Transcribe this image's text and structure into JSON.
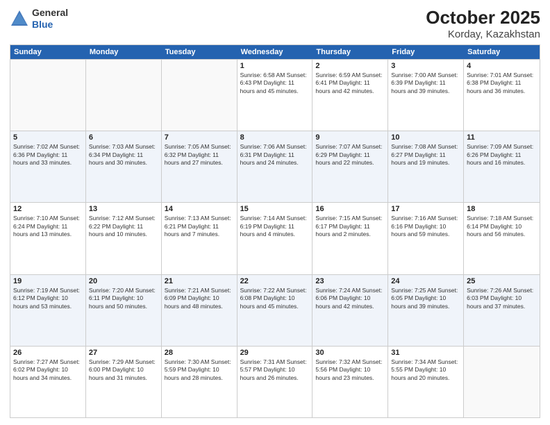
{
  "header": {
    "logo": {
      "general": "General",
      "blue": "Blue"
    },
    "month": "October 2025",
    "location": "Korday, Kazakhstan"
  },
  "days_of_week": [
    "Sunday",
    "Monday",
    "Tuesday",
    "Wednesday",
    "Thursday",
    "Friday",
    "Saturday"
  ],
  "weeks": [
    [
      {
        "day": "",
        "info": ""
      },
      {
        "day": "",
        "info": ""
      },
      {
        "day": "",
        "info": ""
      },
      {
        "day": "1",
        "info": "Sunrise: 6:58 AM\nSunset: 6:43 PM\nDaylight: 11 hours\nand 45 minutes."
      },
      {
        "day": "2",
        "info": "Sunrise: 6:59 AM\nSunset: 6:41 PM\nDaylight: 11 hours\nand 42 minutes."
      },
      {
        "day": "3",
        "info": "Sunrise: 7:00 AM\nSunset: 6:39 PM\nDaylight: 11 hours\nand 39 minutes."
      },
      {
        "day": "4",
        "info": "Sunrise: 7:01 AM\nSunset: 6:38 PM\nDaylight: 11 hours\nand 36 minutes."
      }
    ],
    [
      {
        "day": "5",
        "info": "Sunrise: 7:02 AM\nSunset: 6:36 PM\nDaylight: 11 hours\nand 33 minutes."
      },
      {
        "day": "6",
        "info": "Sunrise: 7:03 AM\nSunset: 6:34 PM\nDaylight: 11 hours\nand 30 minutes."
      },
      {
        "day": "7",
        "info": "Sunrise: 7:05 AM\nSunset: 6:32 PM\nDaylight: 11 hours\nand 27 minutes."
      },
      {
        "day": "8",
        "info": "Sunrise: 7:06 AM\nSunset: 6:31 PM\nDaylight: 11 hours\nand 24 minutes."
      },
      {
        "day": "9",
        "info": "Sunrise: 7:07 AM\nSunset: 6:29 PM\nDaylight: 11 hours\nand 22 minutes."
      },
      {
        "day": "10",
        "info": "Sunrise: 7:08 AM\nSunset: 6:27 PM\nDaylight: 11 hours\nand 19 minutes."
      },
      {
        "day": "11",
        "info": "Sunrise: 7:09 AM\nSunset: 6:26 PM\nDaylight: 11 hours\nand 16 minutes."
      }
    ],
    [
      {
        "day": "12",
        "info": "Sunrise: 7:10 AM\nSunset: 6:24 PM\nDaylight: 11 hours\nand 13 minutes."
      },
      {
        "day": "13",
        "info": "Sunrise: 7:12 AM\nSunset: 6:22 PM\nDaylight: 11 hours\nand 10 minutes."
      },
      {
        "day": "14",
        "info": "Sunrise: 7:13 AM\nSunset: 6:21 PM\nDaylight: 11 hours\nand 7 minutes."
      },
      {
        "day": "15",
        "info": "Sunrise: 7:14 AM\nSunset: 6:19 PM\nDaylight: 11 hours\nand 4 minutes."
      },
      {
        "day": "16",
        "info": "Sunrise: 7:15 AM\nSunset: 6:17 PM\nDaylight: 11 hours\nand 2 minutes."
      },
      {
        "day": "17",
        "info": "Sunrise: 7:16 AM\nSunset: 6:16 PM\nDaylight: 10 hours\nand 59 minutes."
      },
      {
        "day": "18",
        "info": "Sunrise: 7:18 AM\nSunset: 6:14 PM\nDaylight: 10 hours\nand 56 minutes."
      }
    ],
    [
      {
        "day": "19",
        "info": "Sunrise: 7:19 AM\nSunset: 6:12 PM\nDaylight: 10 hours\nand 53 minutes."
      },
      {
        "day": "20",
        "info": "Sunrise: 7:20 AM\nSunset: 6:11 PM\nDaylight: 10 hours\nand 50 minutes."
      },
      {
        "day": "21",
        "info": "Sunrise: 7:21 AM\nSunset: 6:09 PM\nDaylight: 10 hours\nand 48 minutes."
      },
      {
        "day": "22",
        "info": "Sunrise: 7:22 AM\nSunset: 6:08 PM\nDaylight: 10 hours\nand 45 minutes."
      },
      {
        "day": "23",
        "info": "Sunrise: 7:24 AM\nSunset: 6:06 PM\nDaylight: 10 hours\nand 42 minutes."
      },
      {
        "day": "24",
        "info": "Sunrise: 7:25 AM\nSunset: 6:05 PM\nDaylight: 10 hours\nand 39 minutes."
      },
      {
        "day": "25",
        "info": "Sunrise: 7:26 AM\nSunset: 6:03 PM\nDaylight: 10 hours\nand 37 minutes."
      }
    ],
    [
      {
        "day": "26",
        "info": "Sunrise: 7:27 AM\nSunset: 6:02 PM\nDaylight: 10 hours\nand 34 minutes."
      },
      {
        "day": "27",
        "info": "Sunrise: 7:29 AM\nSunset: 6:00 PM\nDaylight: 10 hours\nand 31 minutes."
      },
      {
        "day": "28",
        "info": "Sunrise: 7:30 AM\nSunset: 5:59 PM\nDaylight: 10 hours\nand 28 minutes."
      },
      {
        "day": "29",
        "info": "Sunrise: 7:31 AM\nSunset: 5:57 PM\nDaylight: 10 hours\nand 26 minutes."
      },
      {
        "day": "30",
        "info": "Sunrise: 7:32 AM\nSunset: 5:56 PM\nDaylight: 10 hours\nand 23 minutes."
      },
      {
        "day": "31",
        "info": "Sunrise: 7:34 AM\nSunset: 5:55 PM\nDaylight: 10 hours\nand 20 minutes."
      },
      {
        "day": "",
        "info": ""
      }
    ]
  ]
}
